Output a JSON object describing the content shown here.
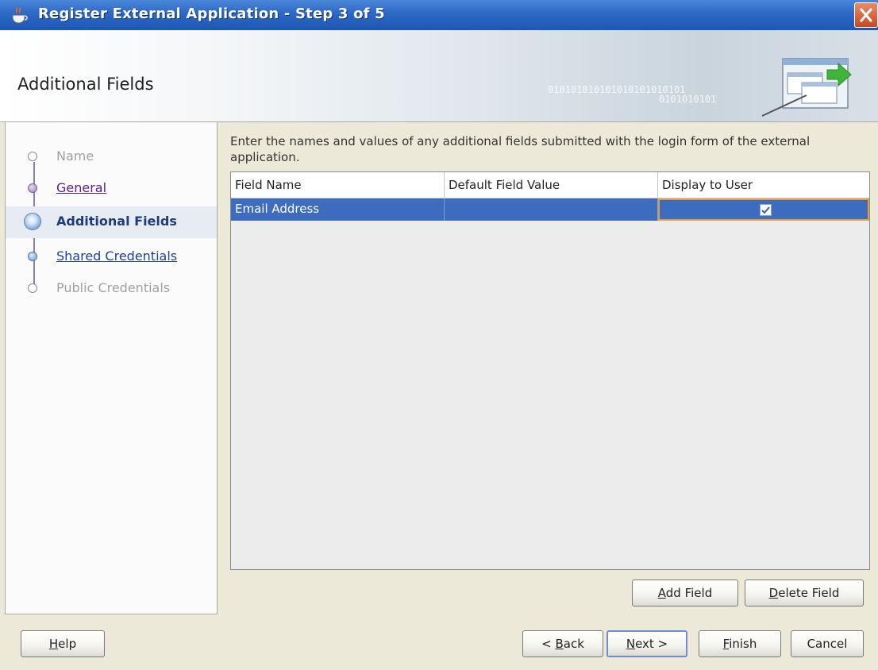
{
  "window": {
    "title": "Register External Application - Step 3 of 5"
  },
  "banner": {
    "title": "Additional Fields",
    "binary_1": "010101010101010101010101",
    "binary_2": "0101010101"
  },
  "steps": [
    {
      "label": "Name",
      "state": "disabled"
    },
    {
      "label": "General",
      "state": "visited"
    },
    {
      "label": "Additional Fields",
      "state": "active"
    },
    {
      "label": "Shared Credentials",
      "state": "link"
    },
    {
      "label": "Public Credentials",
      "state": "disabled"
    }
  ],
  "main": {
    "instructions": "Enter the names and values of any additional fields submitted with the login form of the external application.",
    "table": {
      "columns": [
        "Field Name",
        "Default Field Value",
        "Display to User"
      ],
      "rows": [
        {
          "field_name": "Email Address",
          "default_value": "",
          "display_to_user": true
        }
      ]
    },
    "add_field_label": {
      "mnemonic": "A",
      "rest": "dd Field"
    },
    "delete_field_label": {
      "mnemonic": "D",
      "rest": "elete Field"
    }
  },
  "footer": {
    "help": {
      "mnemonic": "H",
      "rest": "elp"
    },
    "back": {
      "prefix": "< ",
      "mnemonic": "B",
      "rest": "ack"
    },
    "next": {
      "mnemonic": "N",
      "rest": "ext >"
    },
    "finish": {
      "mnemonic": "F",
      "rest": "inish"
    },
    "cancel": "Cancel"
  },
  "colors": {
    "titlebar": "#2c68c6",
    "selection": "#3d6cbf",
    "focus_border": "#e0a03c"
  }
}
